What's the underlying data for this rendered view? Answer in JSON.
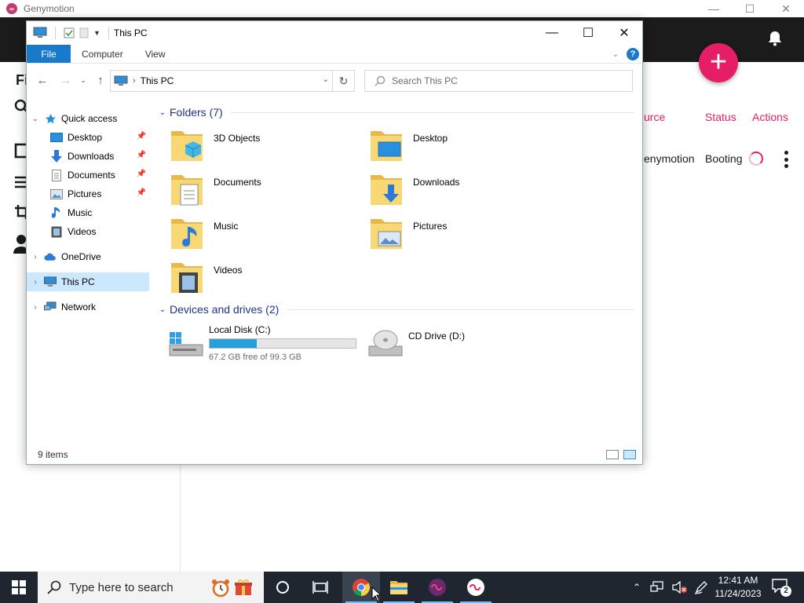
{
  "genymotion": {
    "title": "Genymotion",
    "heading_fragment": "Fi",
    "columns": {
      "source": "urce",
      "status": "Status",
      "actions": "Actions"
    },
    "device_row": {
      "source": "enymotion",
      "status": "Booting"
    },
    "accent": "#e61e68"
  },
  "explorer": {
    "title": "This PC",
    "ribbon_tabs": [
      "File",
      "Computer",
      "View"
    ],
    "address": "This PC",
    "search_placeholder": "Search This PC",
    "nav_tree": {
      "quick_access": "Quick access",
      "pinned": [
        "Desktop",
        "Downloads",
        "Documents",
        "Pictures"
      ],
      "others": [
        "Music",
        "Videos"
      ],
      "onedrive": "OneDrive",
      "this_pc": "This PC",
      "network": "Network"
    },
    "folders_header": "Folders (7)",
    "folders": [
      "3D Objects",
      "Desktop",
      "Documents",
      "Downloads",
      "Music",
      "Pictures",
      "Videos"
    ],
    "drives_header": "Devices and drives (2)",
    "drives": [
      {
        "name": "Local Disk (C:)",
        "free_text": "67.2 GB free of 99.3 GB",
        "used_fraction": 0.323
      },
      {
        "name": "CD Drive (D:)"
      }
    ],
    "status": "9 items",
    "selection_color": "#cce8ff"
  },
  "taskbar": {
    "search_placeholder": "Type here to search",
    "time": "12:41 AM",
    "date": "11/24/2023",
    "notification_count": "2",
    "pinned_apps": [
      "chrome-icon",
      "file-explorer-icon",
      "genymotion-icon",
      "genymotion-player-icon"
    ]
  }
}
